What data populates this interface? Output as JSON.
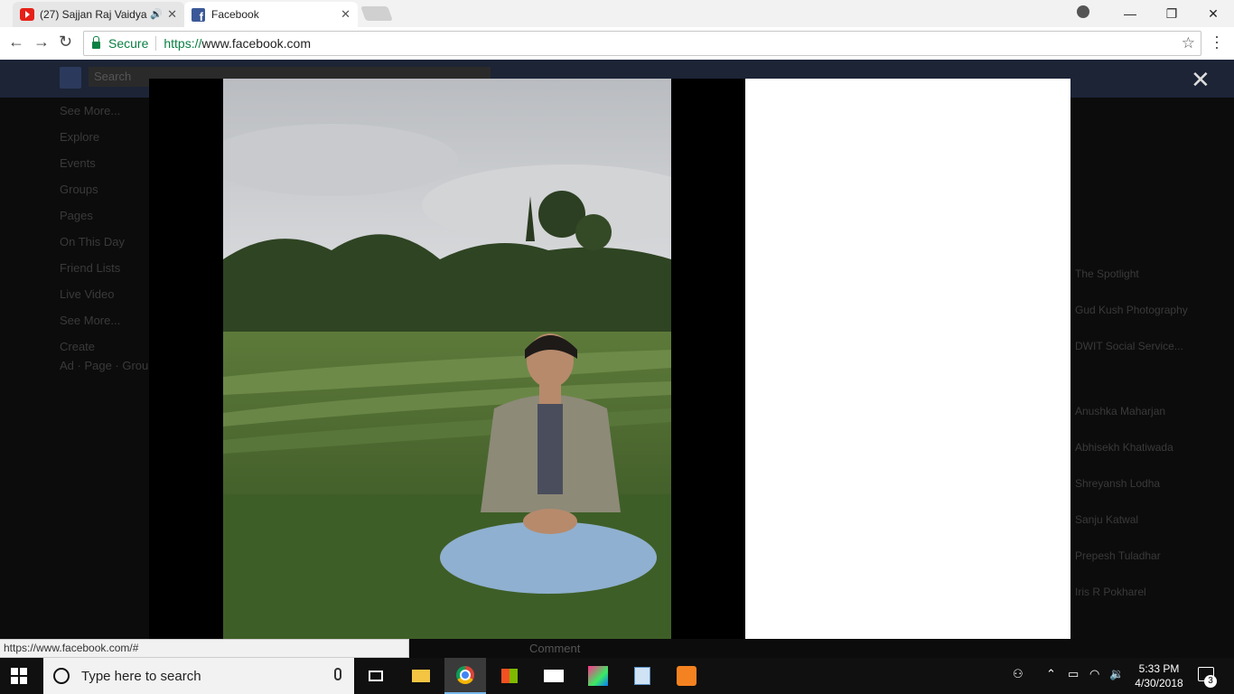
{
  "tabs": [
    {
      "title": "(27) Sajjan Raj Vaidya",
      "icon": "youtube-icon"
    },
    {
      "title": "Facebook",
      "icon": "facebook-icon"
    }
  ],
  "omnibox": {
    "security_label": "Secure",
    "url_scheme": "https://",
    "url_rest": "www.facebook.com"
  },
  "facebook": {
    "search_placeholder": "Search",
    "left_items": [
      "See More...",
      "Explore",
      "Events",
      "Groups",
      "Pages",
      "On This Day",
      "Friend Lists",
      "Live Video",
      "See More...",
      "Create",
      "Ad · Page · Group"
    ],
    "right_items": [
      "The Spotlight",
      "Gud Kush Photography",
      "DWIT Social Service...",
      "Anushka Maharjan",
      "Abhisekh Khatiwada",
      "Shreyansh Lodha",
      "Sanju Katwal",
      "Prepesh Tuladhar",
      "Iris R Pokharel"
    ],
    "comment_label": "Comment"
  },
  "status_url": "https://www.facebook.com/#",
  "taskbar": {
    "search_placeholder": "Type here to search",
    "time": "5:33 PM",
    "date": "4/30/2018",
    "notification_count": "3"
  }
}
